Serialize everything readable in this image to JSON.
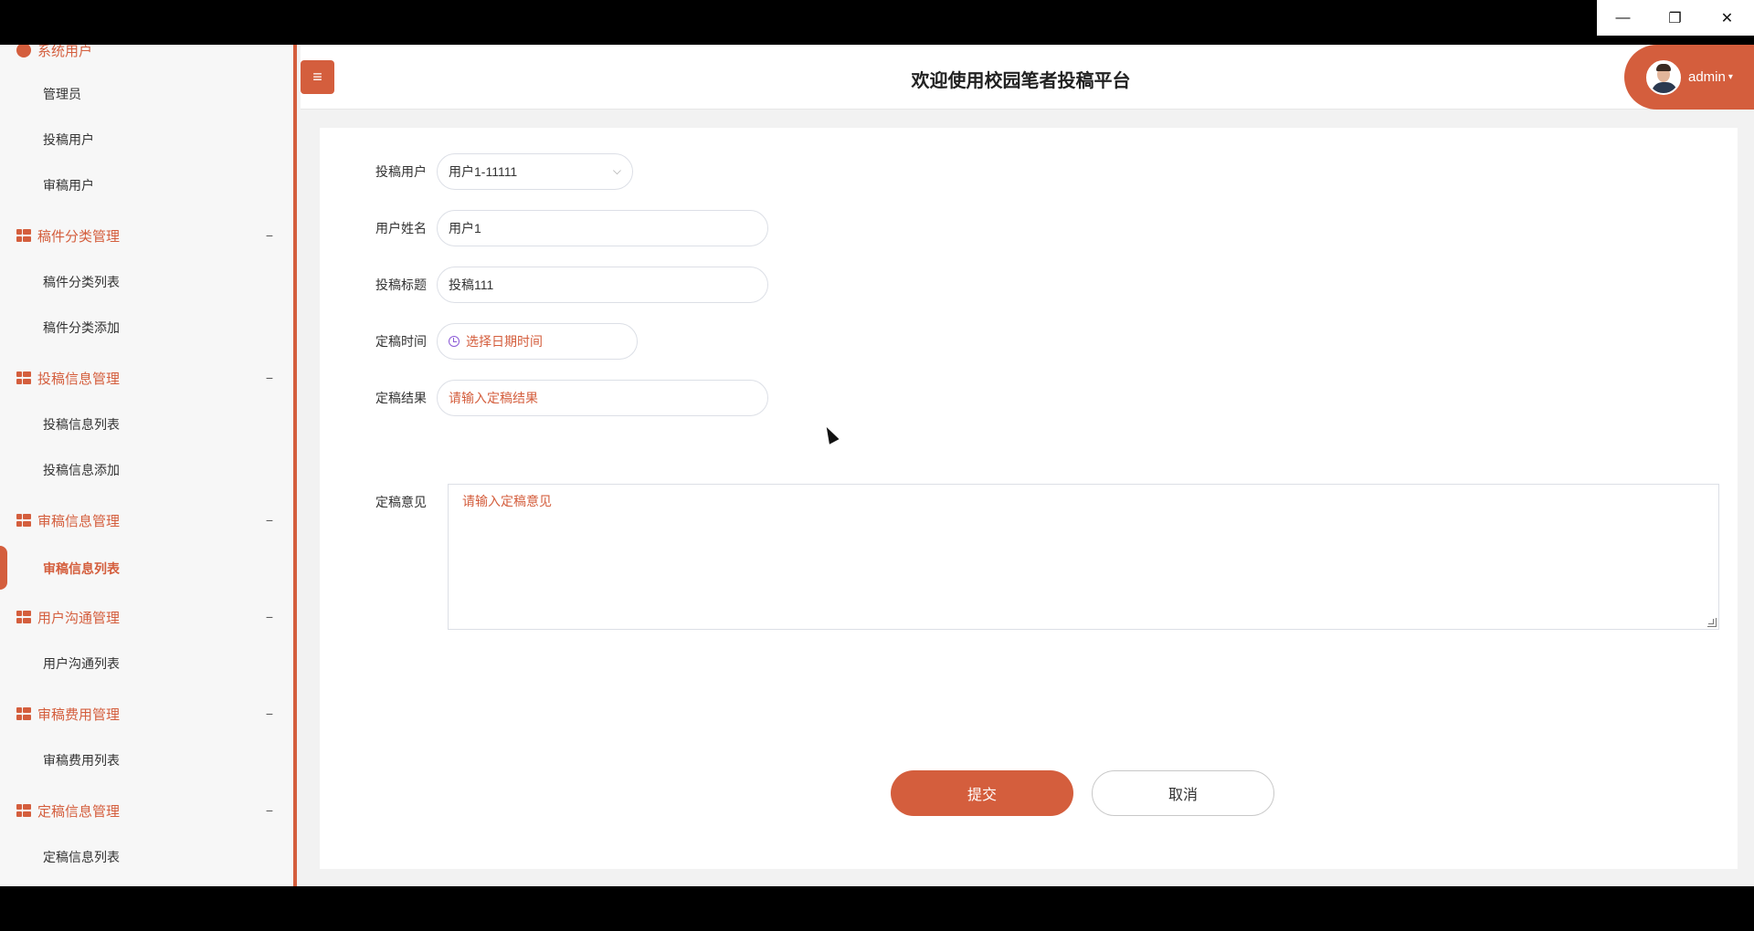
{
  "window": {
    "controls": {
      "minimize": "—",
      "restore": "❐",
      "close": "✕"
    }
  },
  "header": {
    "title": "欢迎使用校园笔者投稿平台",
    "menu_toggle": "≡",
    "admin_name": "admin",
    "caret": "▾"
  },
  "sidebar": {
    "top_group": "系统用户",
    "items": [
      {
        "label": "管理员"
      },
      {
        "label": "投稿用户"
      },
      {
        "label": "审稿用户"
      }
    ],
    "groups": [
      {
        "label": "稿件分类管理",
        "toggle": "−",
        "items": [
          "稿件分类列表",
          "稿件分类添加"
        ]
      },
      {
        "label": "投稿信息管理",
        "toggle": "−",
        "items": [
          "投稿信息列表",
          "投稿信息添加"
        ]
      },
      {
        "label": "审稿信息管理",
        "toggle": "−",
        "items": [
          "审稿信息列表"
        ]
      },
      {
        "label": "用户沟通管理",
        "toggle": "−",
        "items": [
          "用户沟通列表"
        ]
      },
      {
        "label": "审稿费用管理",
        "toggle": "−",
        "items": [
          "审稿费用列表"
        ]
      },
      {
        "label": "定稿信息管理",
        "toggle": "−",
        "items": [
          "定稿信息列表"
        ]
      }
    ],
    "active_item": "审稿信息列表"
  },
  "form": {
    "submit_user": {
      "label": "投稿用户",
      "value": "用户1-11111",
      "arrow": "⌵"
    },
    "user_name": {
      "label": "用户姓名",
      "value": "用户1"
    },
    "title": {
      "label": "投稿标题",
      "value": "投稿111"
    },
    "final_time": {
      "label": "定稿时间",
      "placeholder": "选择日期时间"
    },
    "final_result": {
      "label": "定稿结果",
      "placeholder": "请输入定稿结果"
    },
    "final_opinion": {
      "label": "定稿意见",
      "placeholder": "请输入定稿意见"
    },
    "submit_button": "提交",
    "cancel_button": "取消"
  },
  "colors": {
    "accent": "#d45e3d",
    "sidebar_bg": "#f7f7f7",
    "content_bg": "#f2f2f2"
  }
}
